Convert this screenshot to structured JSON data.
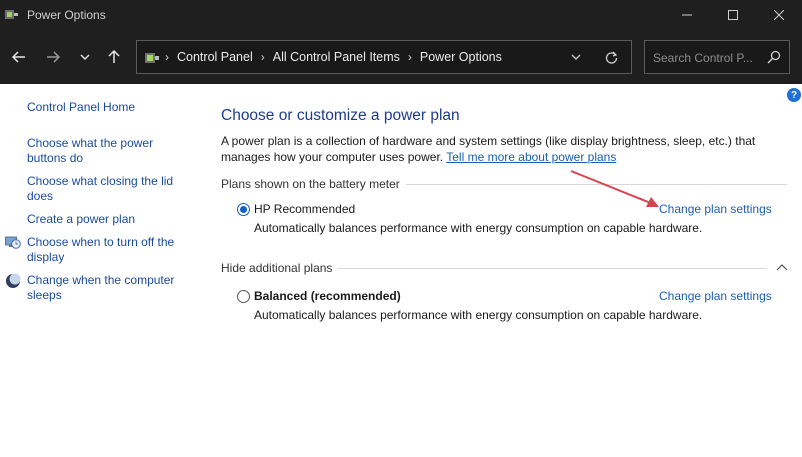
{
  "window": {
    "title": "Power Options",
    "controls": {
      "minimize": "minimize",
      "maximize": "maximize",
      "close": "close"
    }
  },
  "nav": {
    "breadcrumbs": [
      "Control Panel",
      "All Control Panel Items",
      "Power Options"
    ],
    "search_placeholder": "Search Control P..."
  },
  "help_label": "?",
  "sidebar": {
    "home": "Control Panel Home",
    "links": [
      {
        "line1": "Choose what the power",
        "line2": "buttons do",
        "icon": "none"
      },
      {
        "line1": "Choose what closing the lid",
        "line2": "does",
        "icon": "none"
      },
      {
        "line1": "Create a power plan",
        "line2": "",
        "icon": "none"
      },
      {
        "line1": "Choose when to turn off the",
        "line2": "display",
        "icon": "monitor-clock-icon"
      },
      {
        "line1": "Change when the computer",
        "line2": "sleeps",
        "icon": "moon-icon"
      }
    ]
  },
  "main": {
    "title": "Choose or customize a power plan",
    "description": "A power plan is a collection of hardware and system settings (like display brightness, sleep, etc.) that",
    "description_line2": "manages how your computer uses power.",
    "learn_more_link": "Tell me more about power plans",
    "battery_section_label": "Plans shown on the battery meter",
    "hidden_section_label": "Hide additional plans",
    "plans": [
      {
        "name": "HP Recommended",
        "selected": true,
        "bold": false,
        "description": "Automatically balances performance with energy consumption on capable hardware.",
        "link": "Change plan settings"
      },
      {
        "name": "Balanced (recommended)",
        "selected": false,
        "bold": true,
        "description": "Automatically balances performance with energy consumption on capable hardware.",
        "link": "Change plan settings"
      }
    ]
  },
  "annotation": {
    "type": "red-arrow",
    "points_to": "Change plan settings",
    "color": "#d9434f"
  },
  "colors": {
    "titlebar_bg": "#1f1f1f",
    "link": "#1a5fb4",
    "heading": "#1e3c8c",
    "radio_accent": "#1160c4"
  }
}
